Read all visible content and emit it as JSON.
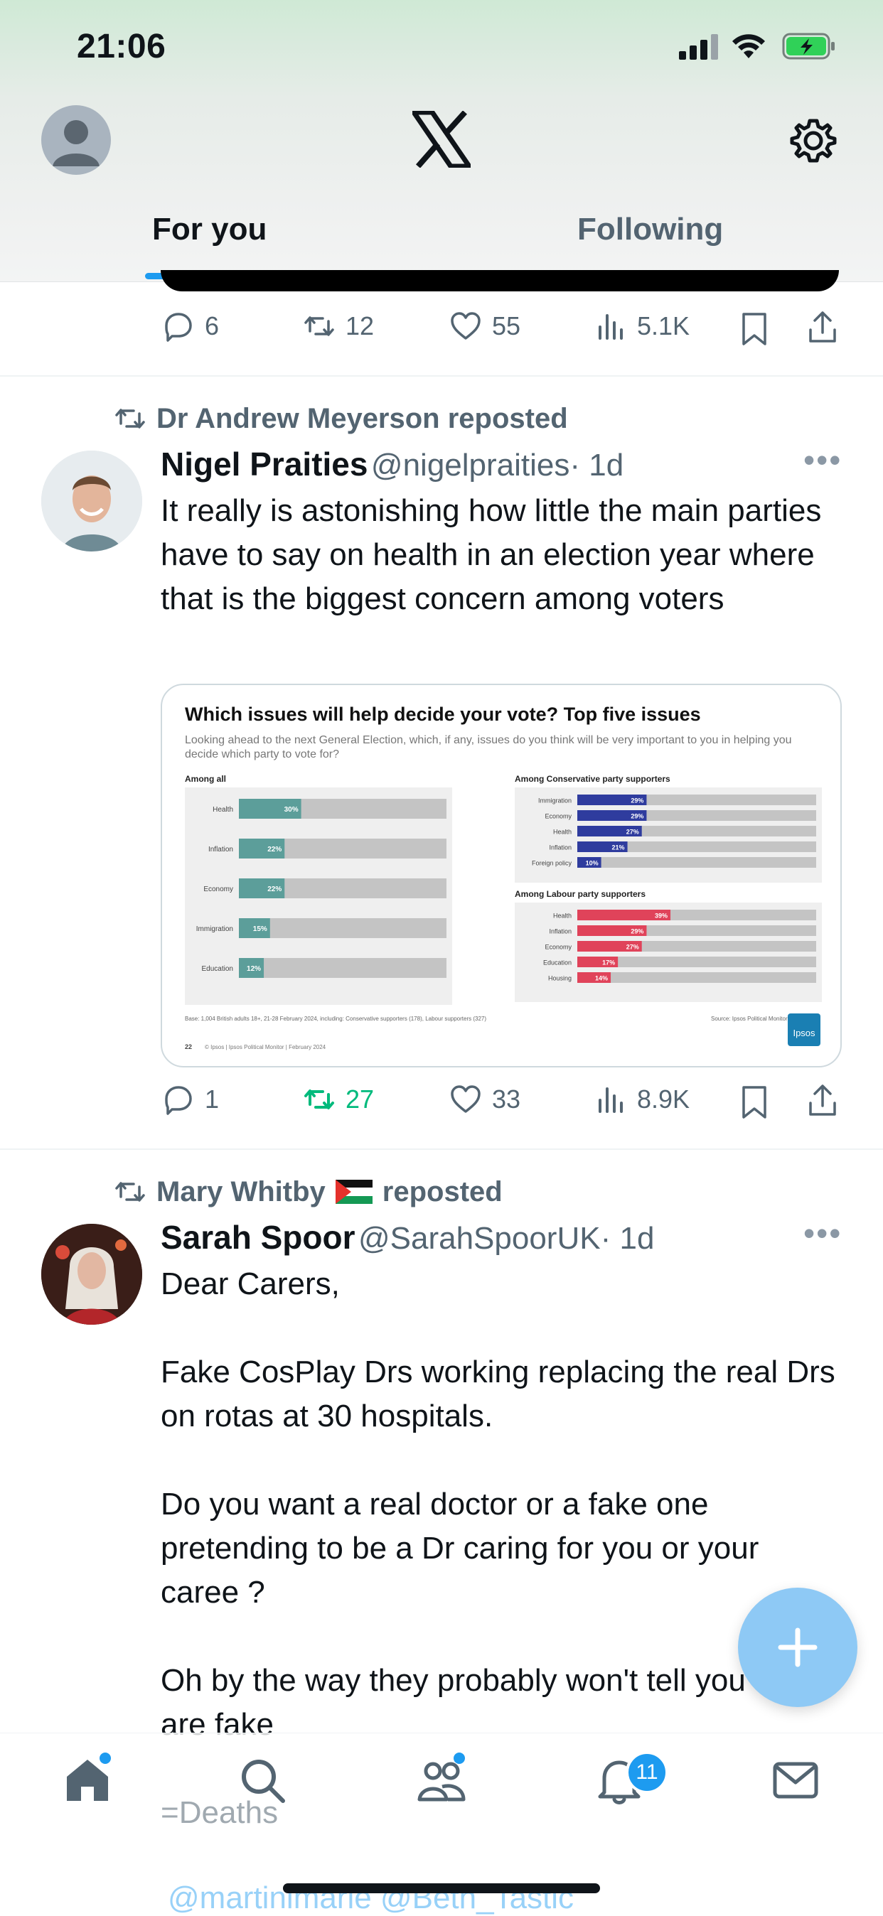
{
  "status_bar": {
    "time": "21:06"
  },
  "header": {
    "tabs": [
      {
        "label": "For you",
        "active": true
      },
      {
        "label": "Following",
        "active": false
      }
    ]
  },
  "prev_tweet_actions": {
    "replies": "6",
    "reposts": "12",
    "likes": "55",
    "views": "5.1K"
  },
  "tweet1": {
    "reposted_by": "Dr Andrew Meyerson reposted",
    "name": "Nigel Praities",
    "handle": "@nigelpraities",
    "time": "· 1d",
    "text": "It really is astonishing how little the main parties have to say on health in an election year where that is the biggest concern among voters",
    "card": {
      "title": "Which issues will help decide your vote? Top five issues",
      "subtitle": "Looking ahead to the next General Election, which, if any, issues do you think will be very important to you in helping you decide which party to vote for?",
      "footer_base": "Base: 1,004 British adults 18+, 21-28 February 2024, including: Conservative supporters (178), Labour supporters (327)",
      "footer_copy": "© Ipsos | Ipsos Political Monitor | February 2024",
      "page_num": "22",
      "source": "Source: Ipsos Political Monitor",
      "logo": "Ipsos"
    },
    "actions": {
      "replies": "1",
      "reposts": "27",
      "likes": "33",
      "views": "8.9K"
    }
  },
  "tweet2": {
    "reposted_by": "Mary Whitby",
    "reposted_suffix": "reposted",
    "name": "Sarah Spoor",
    "handle": "@SarahSpoorUK",
    "time": "· 1d",
    "paragraphs": [
      "Dear Carers,",
      "Fake CosPlay Drs working replacing the real Drs on rotas at 30 hospitals.",
      "Do you want a real doctor or a fake one pretending to be a Dr caring for you or your caree ?",
      "Oh by the way they probably won't tell you they are fake",
      "=Deaths",
      "@martinimarie @Beth_Tastic"
    ]
  },
  "bottom_nav": {
    "notifications_badge": "11"
  },
  "colors": {
    "accent": "#1d9bf0",
    "repost_active": "#00ba7c",
    "ipsos_teal": "#5c9e9a",
    "con_blue": "#2f3c9e",
    "lab_red": "#e0435a"
  },
  "chart_data": [
    {
      "type": "bar",
      "title": "Among all",
      "categories": [
        "Health",
        "Inflation",
        "Economy",
        "Immigration",
        "Education"
      ],
      "values": [
        30,
        22,
        22,
        15,
        12
      ],
      "value_labels": [
        "30%",
        "22%",
        "22%",
        "15%",
        "12%"
      ],
      "ylim": [
        0,
        100
      ]
    },
    {
      "type": "bar",
      "title": "Among Conservative party supporters",
      "categories": [
        "Immigration",
        "Economy",
        "Health",
        "Inflation",
        "Foreign policy"
      ],
      "values": [
        29,
        29,
        27,
        21,
        10
      ],
      "value_labels": [
        "29%",
        "29%",
        "27%",
        "21%",
        "10%"
      ],
      "ylim": [
        0,
        100
      ]
    },
    {
      "type": "bar",
      "title": "Among Labour party supporters",
      "categories": [
        "Health",
        "Inflation",
        "Economy",
        "Education",
        "Housing"
      ],
      "values": [
        39,
        29,
        27,
        17,
        14
      ],
      "value_labels": [
        "39%",
        "29%",
        "27%",
        "17%",
        "14%"
      ],
      "ylim": [
        0,
        100
      ]
    }
  ]
}
